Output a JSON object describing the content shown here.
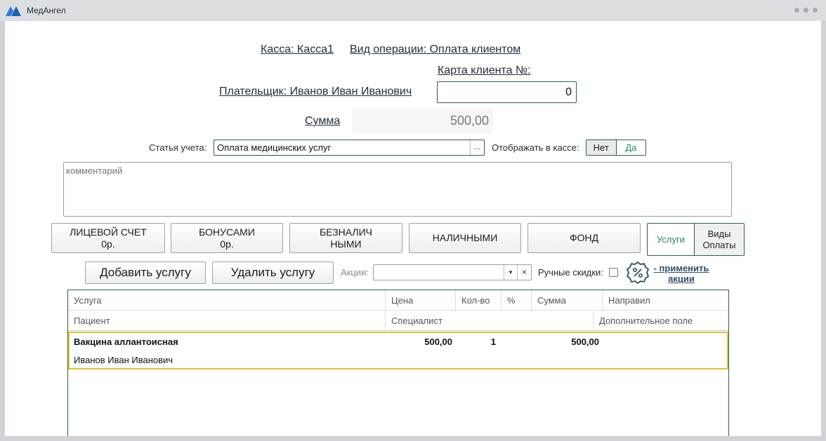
{
  "app": {
    "title": "МедАнгел"
  },
  "header": {
    "kassa": "Касса: Касса1",
    "operation": "Вид операции: Оплата клиентом",
    "card_label": "Карта клиента №:",
    "card_value": "0",
    "payer": "Плательщик: Иванов Иван Иванович",
    "sum_label": "Сумма",
    "sum_value": "500,00"
  },
  "accounting": {
    "article_label": "Статья учета:",
    "article_value": "Оплата медицинских услуг",
    "article_dots": "...",
    "display_label": "Отображать в кассе:",
    "toggle_no": "Нет",
    "toggle_yes": "Да",
    "toggle_selected": "Нет"
  },
  "comment": {
    "placeholder": "комментарий"
  },
  "payment_buttons": [
    {
      "line1": "ЛИЦЕВОЙ СЧЕТ",
      "line2": "0р."
    },
    {
      "line1": "БОНУСАМИ",
      "line2": "0р."
    },
    {
      "line1": "БЕЗНАЛИЧ",
      "line2": "НЫМИ"
    },
    {
      "line1": "НАЛИЧНЫМИ",
      "line2": ""
    },
    {
      "line1": "ФОНД",
      "line2": ""
    }
  ],
  "view_switch": {
    "services": "Услуги",
    "pay_types_line1": "Виды",
    "pay_types_line2": "Оплаты",
    "active": "Услуги"
  },
  "actions": {
    "add_service": "Добавить услугу",
    "remove_service": "Удалить услугу",
    "promo_label": "Акции:",
    "promo_value": "",
    "promo_clear": "×",
    "manual_discount_label": "Ручные скидки:",
    "manual_discount_checked": false,
    "apply_line1": "- применить",
    "apply_line2": "акции"
  },
  "table": {
    "header_row1": [
      "Услуга",
      "Цена",
      "Кол-во",
      "%",
      "Сумма",
      "Направил"
    ],
    "header_row2": [
      "Пациент",
      "Специалист",
      "Дополнительное поле"
    ],
    "rows": [
      {
        "service": "Вакцина аллантоисная",
        "price": "500,00",
        "qty": "1",
        "percent": "",
        "sum": "500,00",
        "referred": "",
        "patient": "Иванов Иван Иванович",
        "specialist": "",
        "extra": ""
      }
    ]
  },
  "colors": {
    "accent_green": "#1c8c5a",
    "border_teal": "#2f5b5b",
    "selected_row_border": "#e8c22a",
    "logo_blue": "#2a7de1"
  }
}
